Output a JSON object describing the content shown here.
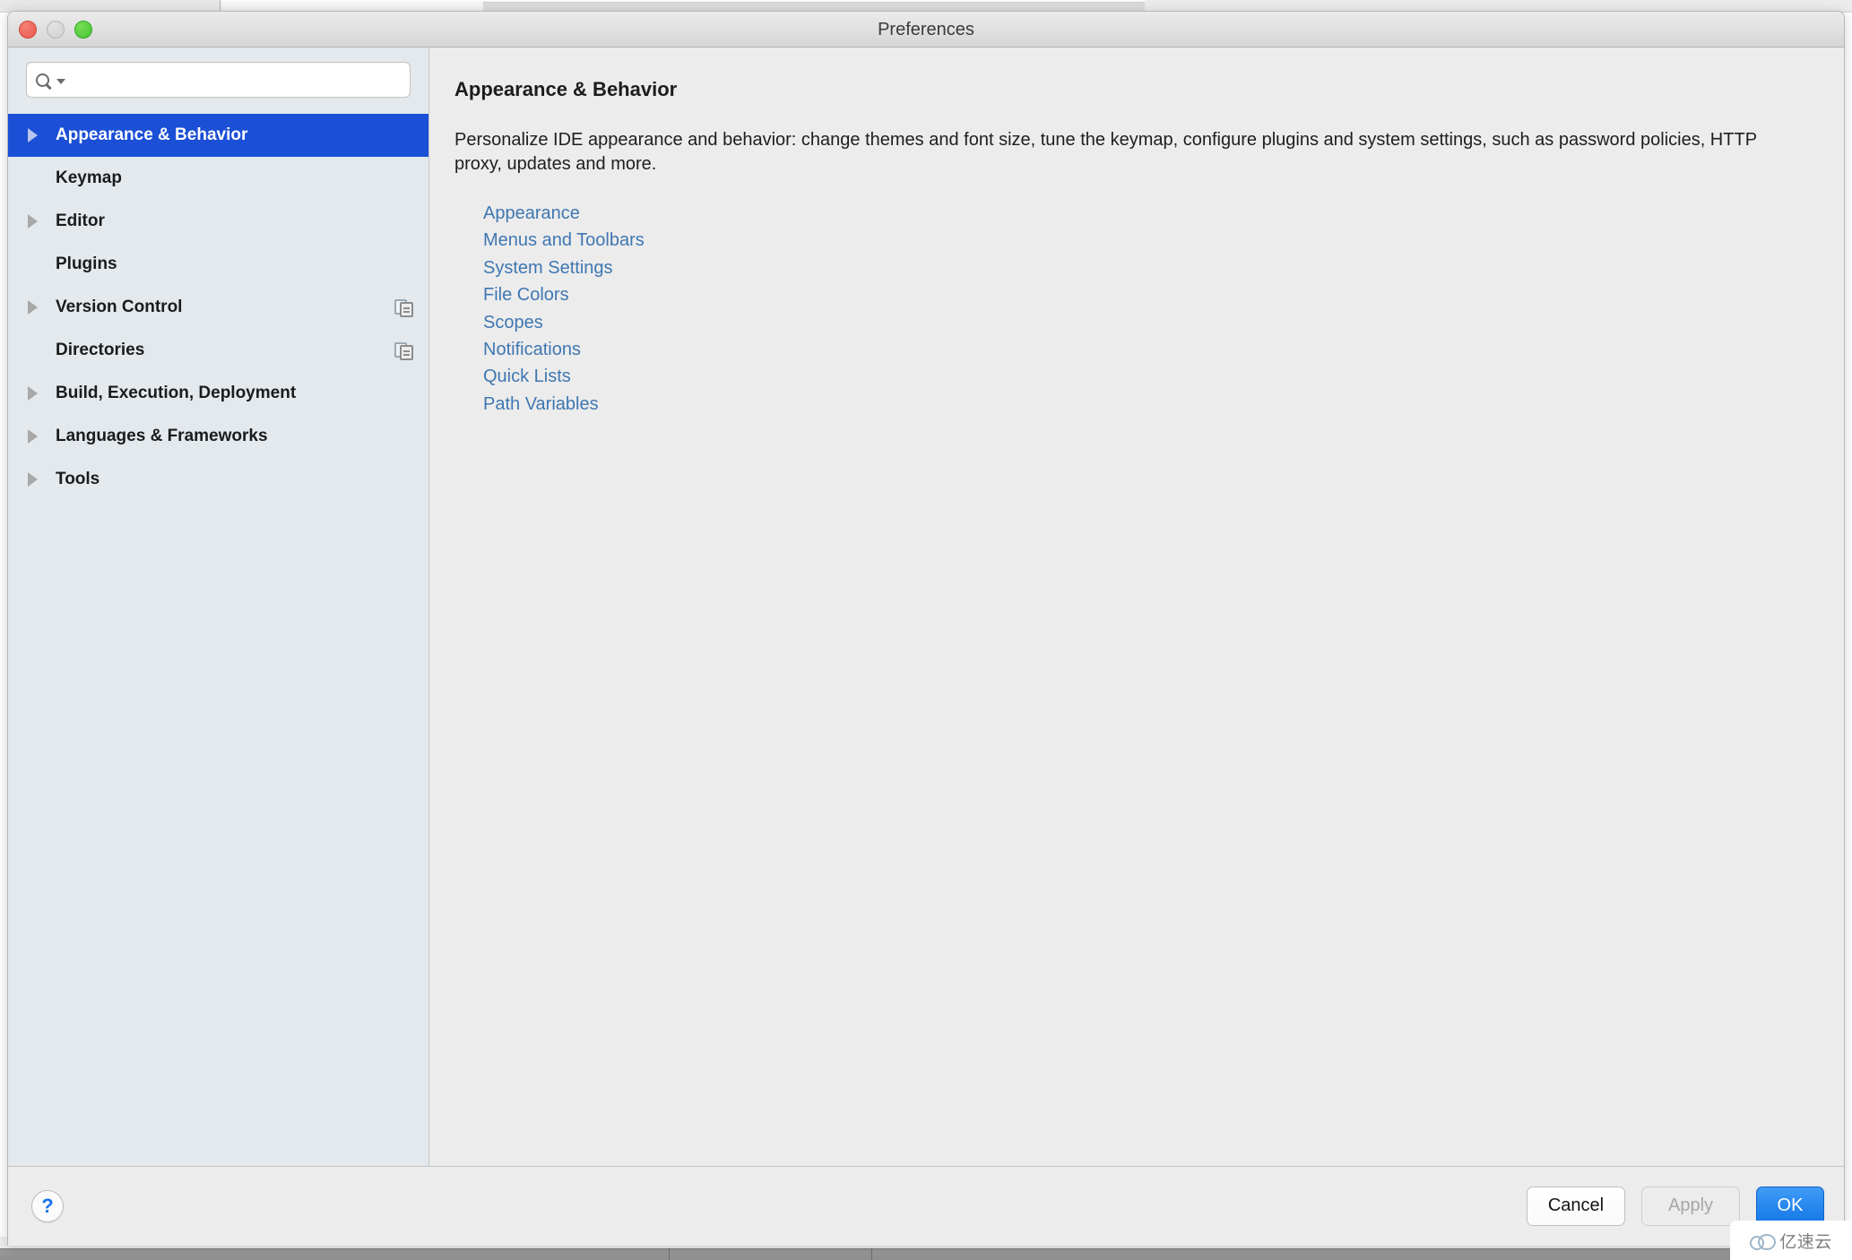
{
  "window": {
    "title": "Preferences",
    "traffic_lights": [
      "close",
      "minimize",
      "maximize"
    ]
  },
  "search": {
    "value": "",
    "placeholder": ""
  },
  "sidebar": {
    "items": [
      {
        "label": "Appearance & Behavior",
        "expandable": true,
        "selected": true,
        "badge": false
      },
      {
        "label": "Keymap",
        "expandable": false,
        "selected": false,
        "badge": false
      },
      {
        "label": "Editor",
        "expandable": true,
        "selected": false,
        "badge": false
      },
      {
        "label": "Plugins",
        "expandable": false,
        "selected": false,
        "badge": false
      },
      {
        "label": "Version Control",
        "expandable": true,
        "selected": false,
        "badge": true
      },
      {
        "label": "Directories",
        "expandable": false,
        "selected": false,
        "badge": true
      },
      {
        "label": "Build, Execution, Deployment",
        "expandable": true,
        "selected": false,
        "badge": false
      },
      {
        "label": "Languages & Frameworks",
        "expandable": true,
        "selected": false,
        "badge": false
      },
      {
        "label": "Tools",
        "expandable": true,
        "selected": false,
        "badge": false
      }
    ]
  },
  "main": {
    "title": "Appearance & Behavior",
    "description": "Personalize IDE appearance and behavior: change themes and font size, tune the keymap, configure plugins and system settings, such as password policies, HTTP proxy, updates and more.",
    "links": [
      "Appearance",
      "Menus and Toolbars",
      "System Settings",
      "File Colors",
      "Scopes",
      "Notifications",
      "Quick Lists",
      "Path Variables"
    ]
  },
  "footer": {
    "help_label": "?",
    "cancel_label": "Cancel",
    "apply_label": "Apply",
    "apply_disabled": true,
    "ok_label": "OK"
  },
  "watermark": {
    "text": "亿速云"
  },
  "colors": {
    "selection_blue": "#1b4fd6",
    "link_blue": "#3f77b2",
    "ok_blue": "#1175e6",
    "sidebar_bg": "#e4e9ed",
    "main_bg": "#ececec"
  }
}
